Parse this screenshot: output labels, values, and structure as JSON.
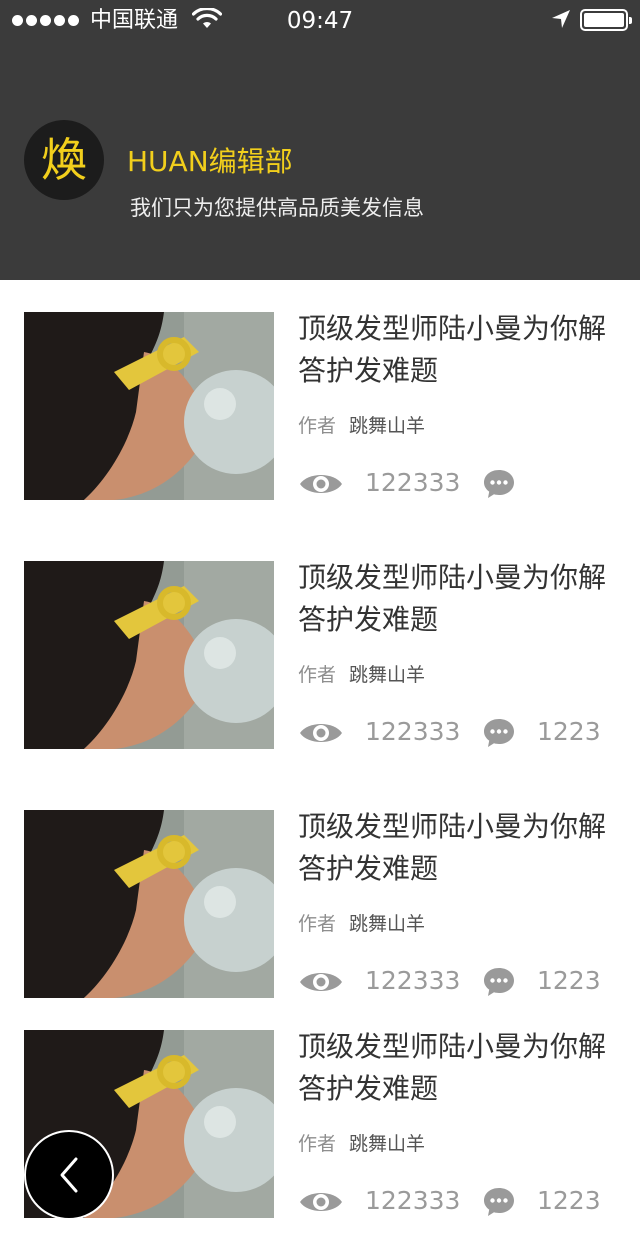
{
  "status_bar": {
    "carrier": "中国联通",
    "time": "09:47",
    "signal_bars": 5,
    "battery_level": 1.0
  },
  "header": {
    "logo_char": "煥",
    "title": "HUAN编辑部",
    "subtitle": "我们只为您提供高品质美发信息",
    "accent_color": "#f2cf1c",
    "background_color": "#3b3b3b"
  },
  "articles": [
    {
      "title": "顶级发型师陆小曼为你解答护发难题",
      "author_label": "作者",
      "author": "跳舞山羊",
      "views": "122333",
      "comments": ""
    },
    {
      "title": "顶级发型师陆小曼为你解答护发难题",
      "author_label": "作者",
      "author": "跳舞山羊",
      "views": "122333",
      "comments": "1223"
    },
    {
      "title": "顶级发型师陆小曼为你解答护发难题",
      "author_label": "作者",
      "author": "跳舞山羊",
      "views": "122333",
      "comments": "1223"
    },
    {
      "title": "顶级发型师陆小曼为你解答护发难题",
      "author_label": "作者",
      "author": "跳舞山羊",
      "views": "122333",
      "comments": "1223"
    }
  ],
  "icons": {
    "views": "eye-icon",
    "comments": "comment-bubble-icon",
    "back": "chevron-left-icon"
  }
}
